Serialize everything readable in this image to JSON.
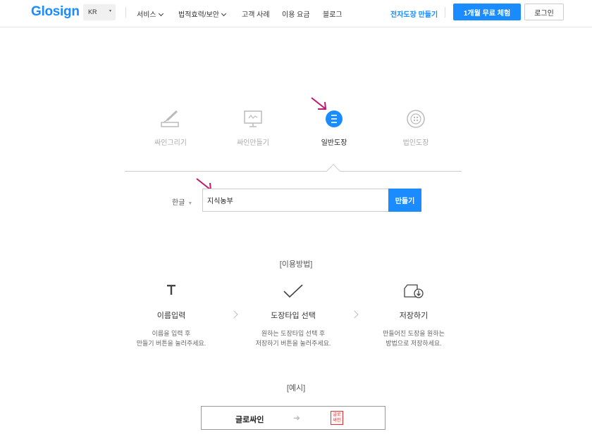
{
  "header": {
    "logo": "Glosign",
    "lang": {
      "code": "KR",
      "caret": "▾"
    },
    "nav": [
      {
        "label": "서비스",
        "has_dropdown": true
      },
      {
        "label": "법적효력/보안",
        "has_dropdown": true
      },
      {
        "label": "고객 사례",
        "has_dropdown": false
      },
      {
        "label": "이용 요금",
        "has_dropdown": false
      },
      {
        "label": "블로그",
        "has_dropdown": false
      }
    ],
    "stamp_link": "전자도장 만들기",
    "trial_button": "1개월 무료 체험",
    "login_button": "로그인"
  },
  "tabs": [
    {
      "label": "싸인그리기",
      "icon": "pen-draw-icon",
      "active": false
    },
    {
      "label": "싸인만들기",
      "icon": "monitor-sign-icon",
      "active": false
    },
    {
      "label": "일반도장",
      "icon": "general-stamp-icon",
      "active": true
    },
    {
      "label": "법인도장",
      "icon": "corporate-stamp-icon",
      "active": false
    }
  ],
  "form": {
    "font_select": "한글",
    "font_select_caret": "▼",
    "name_value": "지식농부",
    "make_button": "만들기"
  },
  "how_to": {
    "title": "[이용방법]",
    "steps": [
      {
        "icon": "text-t-icon",
        "title": "이름입력",
        "desc1": "이름을 입력 후",
        "desc2": "만들기 버튼을 눌러주세요."
      },
      {
        "icon": "checkmark-icon",
        "title": "도장타입 선택",
        "desc1": "원하는 도장타입 선택 후",
        "desc2": "저장하기 버튼을 눌러주세요."
      },
      {
        "icon": "save-download-icon",
        "title": "저장하기",
        "desc1": "만들어진 도장을 원하는",
        "desc2": "방법으로 저장하세요."
      }
    ]
  },
  "example": {
    "title": "[예시]",
    "name": "글로싸인",
    "arrow": "➜",
    "seal_line1": "글로",
    "seal_line2": "싸인"
  },
  "colors": {
    "brand_blue": "#1a8cff",
    "annotation_arrow": "#c0186e"
  }
}
